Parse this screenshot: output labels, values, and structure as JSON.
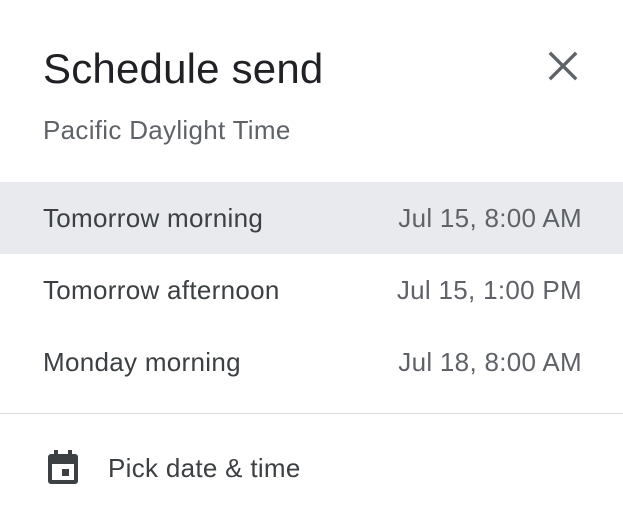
{
  "dialog": {
    "title": "Schedule send",
    "timezone": "Pacific Daylight Time",
    "close_icon": "close-icon"
  },
  "options": [
    {
      "label": "Tomorrow morning",
      "time": "Jul 15, 8:00 AM",
      "selected": true
    },
    {
      "label": "Tomorrow afternoon",
      "time": "Jul 15, 1:00 PM",
      "selected": false
    },
    {
      "label": "Monday morning",
      "time": "Jul 18, 8:00 AM",
      "selected": false
    }
  ],
  "pick": {
    "label": "Pick date & time",
    "icon": "calendar-icon"
  },
  "colors": {
    "selected_bg": "#e8eaed",
    "title": "#202124",
    "text": "#3c4043",
    "secondary_text": "#5f6368",
    "divider": "#dadce0"
  }
}
